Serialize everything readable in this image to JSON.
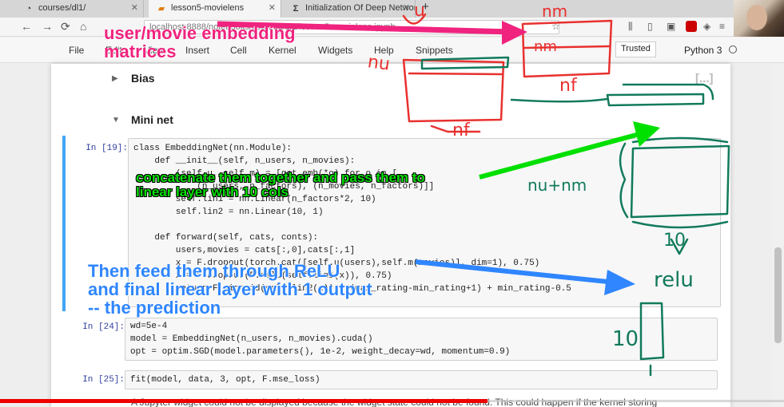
{
  "browser": {
    "tabs": [
      {
        "label": "courses/dl1/",
        "icon": "folder-icon",
        "active": false
      },
      {
        "label": "lesson5-movielens",
        "icon": "notebook-icon",
        "active": true
      },
      {
        "label": "Initialization Of Deep Network",
        "icon": "sigma-icon",
        "active": false
      }
    ],
    "new_tab": "+",
    "url": "localhost:8888/notebooks/courses/dl1/lesson5-movielens.ipynb"
  },
  "menu": {
    "items": [
      "File",
      "Edit",
      "View",
      "Insert",
      "Cell",
      "Kernel",
      "Widgets",
      "Help",
      "Snippets"
    ],
    "trusted": "Trusted",
    "kernel": "Python 3"
  },
  "notebook": {
    "bias_heading": "Bias",
    "collapsed_marker": "[...]",
    "mininet_heading": "Mini net",
    "cells": [
      {
        "prompt": "In [19]:",
        "lines": [
          "class EmbeddingNet(nn.Module):",
          "    def __init__(self, n_users, n_movies):",
          "        (self.u, self.m) = [get_emb(*o) for o in [",
          "            (n_users, n_factors), (n_movies, n_factors)]]",
          "        self.lin1 = nn.Linear(n_factors*2, 10)",
          "        self.lin2 = nn.Linear(10, 1)",
          "",
          "    def forward(self, cats, conts):",
          "        users,movies = cats[:,0],cats[:,1]",
          "        x = F.dropout(torch.cat([self.u(users),self.m(movies)], dim=1), 0.75)",
          "        x = F.dropout(F.relu(self.lin1(x)), 0.75)",
          "        return F.sigmoid(self.lin2(x)) * (max_rating-min_rating+1) + min_rating-0.5"
        ]
      },
      {
        "prompt": "In [24]:",
        "lines": [
          "wd=5e-4",
          "model = EmbeddingNet(n_users, n_movies).cuda()",
          "opt = optim.SGD(model.parameters(), 1e-2, weight_decay=wd, momentum=0.9)"
        ]
      },
      {
        "prompt": "In [25]:",
        "lines": [
          "fit(model, data, 3, opt, F.mse_loss)"
        ]
      }
    ],
    "output_text": "A Jupyter widget could not be displayed because the widget state could not be found. This could happen if the kernel storing"
  },
  "annotations": {
    "magenta": "user/movie embedding\nmatrices",
    "green": "concatenate them together and pass them to\nlinear layer with 10 cols",
    "blue": "Then feed them through ReLU\nand final linear layer with 1 output\n-- the prediction"
  },
  "handwriting": {
    "u": "u",
    "nm": "nm",
    "nu": "nu",
    "nf_left": "nf",
    "nf_right": "nf",
    "nu_plus_nm": "nu+nm",
    "ten": "10",
    "relu": "relu",
    "ten_bottom": "10",
    "one": "1"
  },
  "colors": {
    "magenta": "#f0237f",
    "green": "#00e000",
    "blue": "#2f86ff",
    "ink_red": "#e8312f",
    "ink_teal": "#127a5c",
    "progress": "#ee0000"
  }
}
